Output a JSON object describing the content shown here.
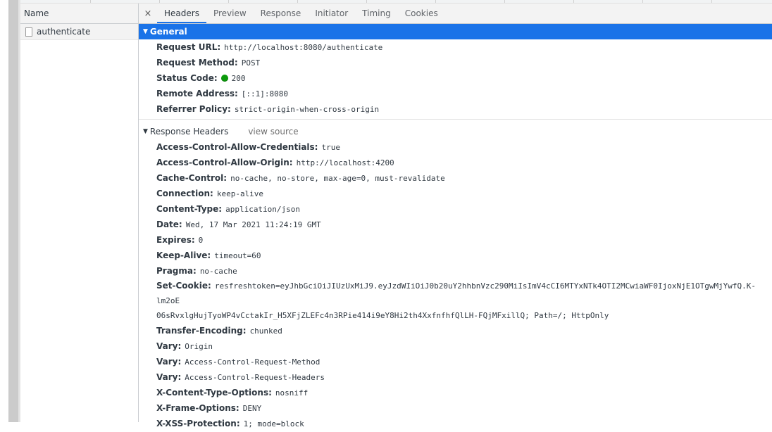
{
  "name_column": {
    "header": "Name",
    "request_name": "authenticate"
  },
  "tabs": [
    "Headers",
    "Preview",
    "Response",
    "Initiator",
    "Timing",
    "Cookies"
  ],
  "close_glyph": "×",
  "general": {
    "title": "General",
    "request_url_label": "Request URL:",
    "request_url": "http://localhost:8080/authenticate",
    "request_method_label": "Request Method:",
    "request_method": "POST",
    "status_code_label": "Status Code:",
    "status_code": "200",
    "remote_address_label": "Remote Address:",
    "remote_address": "[::1]:8080",
    "referrer_policy_label": "Referrer Policy:",
    "referrer_policy": "strict-origin-when-cross-origin"
  },
  "response_headers": {
    "title": "Response Headers",
    "view_source": "view source",
    "items": [
      {
        "k": "Access-Control-Allow-Credentials:",
        "v": "true"
      },
      {
        "k": "Access-Control-Allow-Origin:",
        "v": "http://localhost:4200"
      },
      {
        "k": "Cache-Control:",
        "v": "no-cache, no-store, max-age=0, must-revalidate"
      },
      {
        "k": "Connection:",
        "v": "keep-alive"
      },
      {
        "k": "Content-Type:",
        "v": "application/json"
      },
      {
        "k": "Date:",
        "v": "Wed, 17 Mar 2021 11:24:19 GMT"
      },
      {
        "k": "Expires:",
        "v": "0"
      },
      {
        "k": "Keep-Alive:",
        "v": "timeout=60"
      },
      {
        "k": "Pragma:",
        "v": "no-cache"
      }
    ],
    "set_cookie_label": "Set-Cookie:",
    "set_cookie_line1": "resfreshtoken=eyJhbGciOiJIUzUxMiJ9.eyJzdWIiOiJ0b20uY2hhbnVzc290MiIsImV4cCI6MTYxNTk4OTI2MCwiaWF0IjoxNjE1OTgwMjYwfQ.K-lm2oE",
    "set_cookie_line2": "06sRvxlgHujTyoWP4vCctakIr_H5XFjZLEFc4n3RPie414i9eY8Hi2th4XxfnfhfQlLH-FQjMFxillQ; Path=/; HttpOnly",
    "items2": [
      {
        "k": "Transfer-Encoding:",
        "v": "chunked"
      },
      {
        "k": "Vary:",
        "v": "Origin"
      },
      {
        "k": "Vary:",
        "v": "Access-Control-Request-Method"
      },
      {
        "k": "Vary:",
        "v": "Access-Control-Request-Headers"
      },
      {
        "k": "X-Content-Type-Options:",
        "v": "nosniff"
      },
      {
        "k": "X-Frame-Options:",
        "v": "DENY"
      },
      {
        "k": "X-XSS-Protection:",
        "v": "1; mode=block"
      }
    ]
  },
  "colors": {
    "accent": "#1a73e8",
    "status_ok": "#0c9a0c"
  }
}
